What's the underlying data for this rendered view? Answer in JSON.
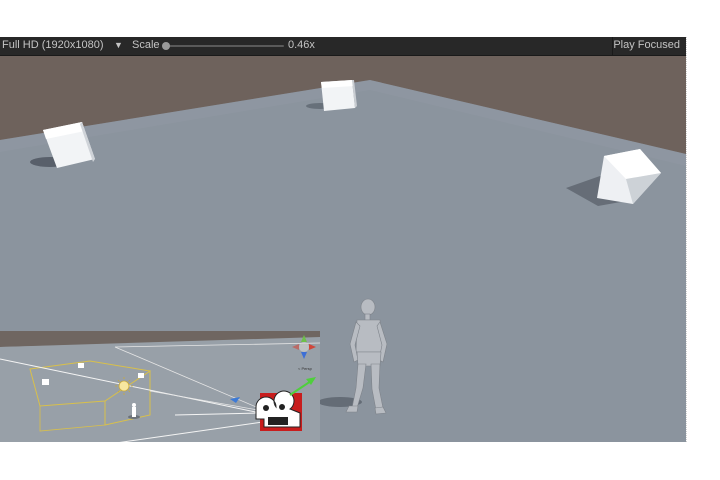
{
  "toolbar": {
    "resolution_label": "Full HD (1920x1080)",
    "dropdown_arrow": "▼",
    "scale_label": "Scale",
    "scale_value": "0.46x",
    "scale_fraction": 0.0,
    "play_focused_label": "Play Focused"
  },
  "scene": {
    "sky_color": "#6e625c",
    "floor_color": "#8b949e",
    "cube_color": "#f2f4f6",
    "character_color": "#b8bcc2"
  },
  "minimap": {
    "gizmo_label": "< Persp",
    "icons": [
      "sun-icon",
      "camera-icon",
      "gizmo-axes-icon"
    ]
  }
}
